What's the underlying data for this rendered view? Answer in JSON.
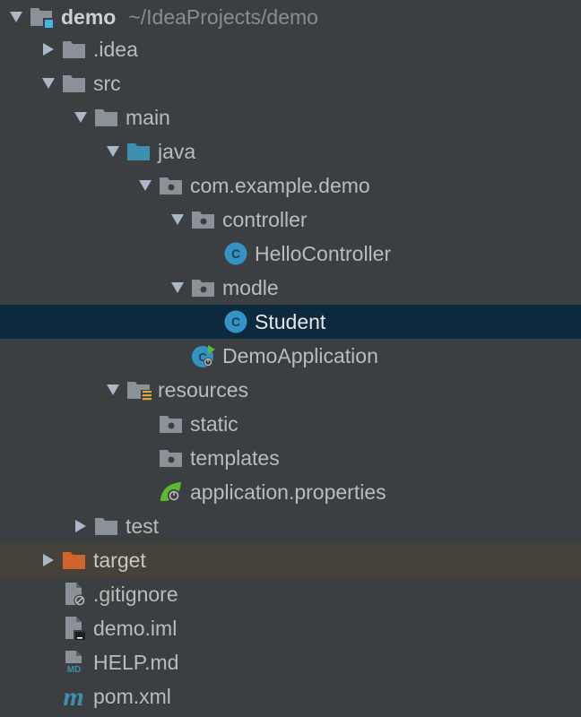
{
  "tree": {
    "root": {
      "label": "demo",
      "path": "~/IdeaProjects/demo"
    },
    "items": [
      {
        "label": ".idea"
      },
      {
        "label": "src"
      },
      {
        "label": "main"
      },
      {
        "label": "java"
      },
      {
        "label": "com.example.demo"
      },
      {
        "label": "controller"
      },
      {
        "label": "HelloController"
      },
      {
        "label": "modle"
      },
      {
        "label": "Student"
      },
      {
        "label": "DemoApplication"
      },
      {
        "label": "resources"
      },
      {
        "label": "static"
      },
      {
        "label": "templates"
      },
      {
        "label": "application.properties"
      },
      {
        "label": "test"
      },
      {
        "label": "target"
      },
      {
        "label": ".gitignore"
      },
      {
        "label": "demo.iml"
      },
      {
        "label": "HELP.md"
      },
      {
        "label": "pom.xml"
      }
    ]
  },
  "colors": {
    "background": "#3c3f41",
    "selection": "#0d293e",
    "excluded_row": "#45423a",
    "folder": "#8a9199",
    "source_folder": "#3d8fb0",
    "excluded_folder": "#d0652b",
    "class_icon": "#3592c4"
  }
}
